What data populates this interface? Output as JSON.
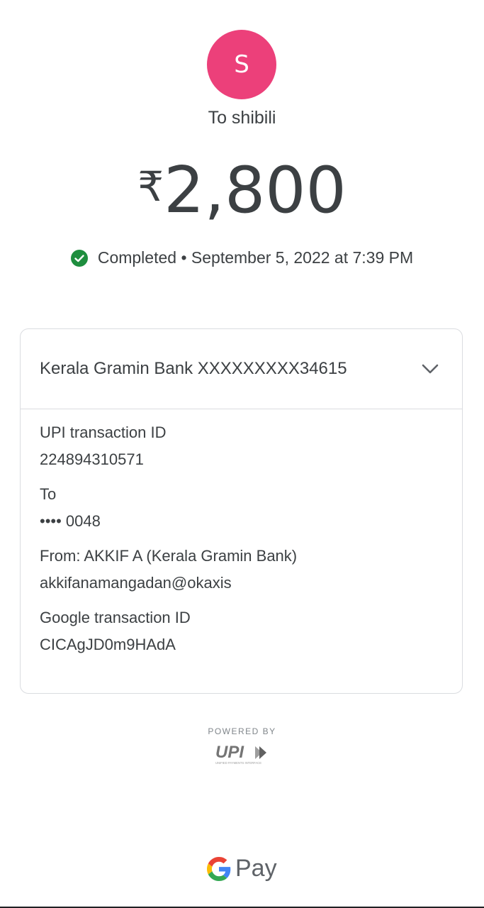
{
  "recipient": {
    "avatar_initial": "S",
    "avatar_color": "#ec407a",
    "to_label": "To shibili"
  },
  "payment": {
    "currency_symbol": "₹",
    "amount": "2,800",
    "status": "Completed",
    "separator": " • ",
    "datetime": "September 5, 2022 at 7:39 PM",
    "status_color": "#1e8e3e"
  },
  "card": {
    "bank_account": "Kerala Gramin Bank XXXXXXXXX34615",
    "details": [
      {
        "label": "UPI transaction ID",
        "value": "224894310571"
      },
      {
        "label": "To",
        "value": "•••• 0048"
      },
      {
        "label": "From: AKKIF A (Kerala Gramin Bank)",
        "value": "akkifanamangadan@okaxis"
      },
      {
        "label": "Google transaction ID",
        "value": "CICAgJD0m9HAdA"
      }
    ]
  },
  "footer": {
    "powered_by": "POWERED BY",
    "upi_logo_text": "UPI",
    "upi_logo_subtext": "UNIFIED PAYMENTS INTERFACE",
    "brand": "Pay"
  }
}
